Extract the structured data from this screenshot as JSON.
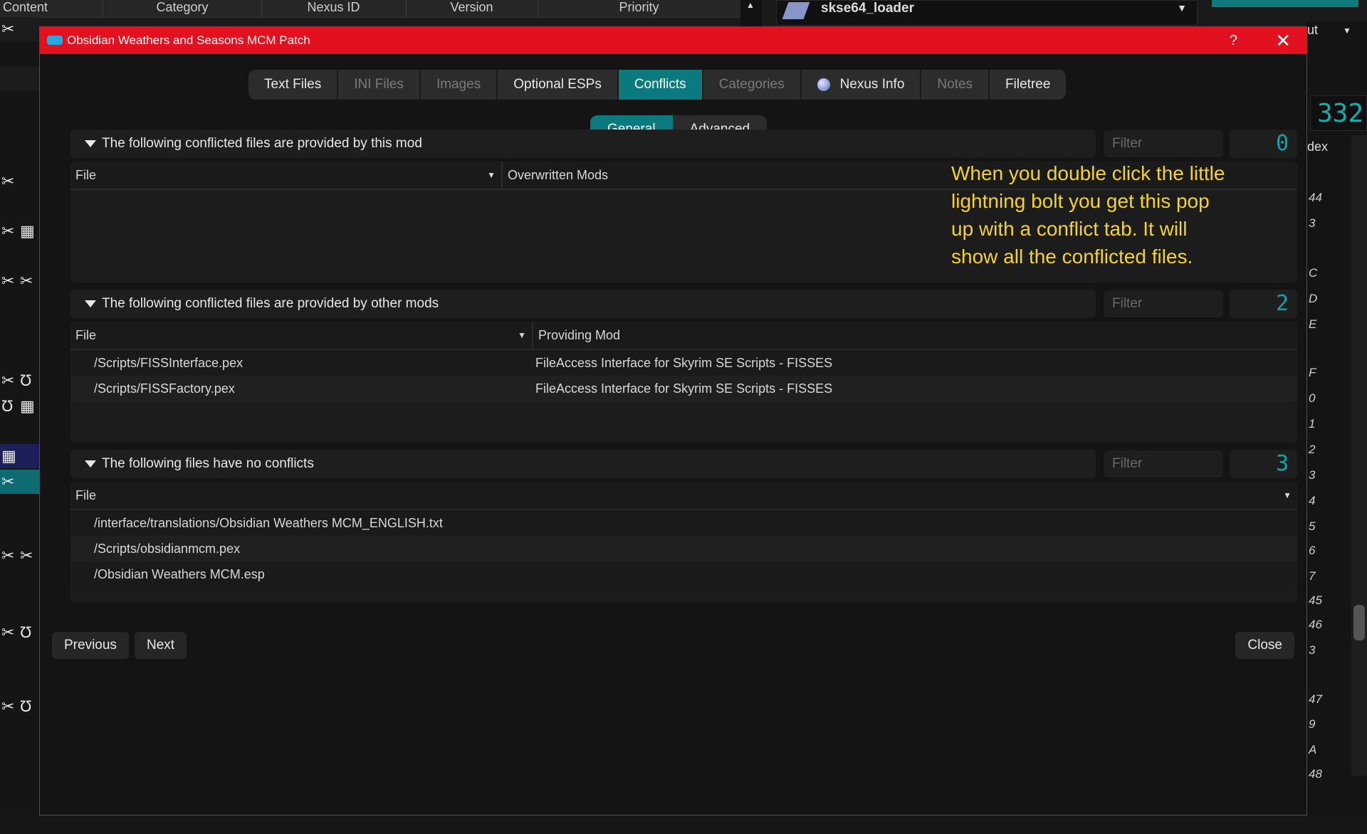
{
  "background": {
    "columns": [
      "Content",
      "Category",
      "Nexus ID",
      "Version",
      "Priority"
    ],
    "executable": "skse64_loader",
    "lcd_value": "332",
    "right_partial_label": "ut",
    "right_partial_header": "dex",
    "right_index_numbers": [
      "44",
      "3",
      "C",
      "D",
      "E",
      "F",
      "0",
      "1",
      "2",
      "3",
      "4",
      "5",
      "6",
      "7",
      "45",
      "46",
      "3",
      "47",
      "9",
      "A",
      "48"
    ]
  },
  "dialog": {
    "title": "Obsidian Weathers and Seasons MCM Patch",
    "help_glyph": "?",
    "close_glyph": "✕",
    "tabs": [
      {
        "label": "Text Files",
        "state": "normal"
      },
      {
        "label": "INI Files",
        "state": "dim"
      },
      {
        "label": "Images",
        "state": "dim"
      },
      {
        "label": "Optional ESPs",
        "state": "normal"
      },
      {
        "label": "Conflicts",
        "state": "active"
      },
      {
        "label": "Categories",
        "state": "dim"
      },
      {
        "label": "Nexus Info",
        "state": "normal",
        "icon": "globe-icon"
      },
      {
        "label": "Notes",
        "state": "dim"
      },
      {
        "label": "Filetree",
        "state": "normal"
      }
    ],
    "subtabs": [
      {
        "label": "General",
        "state": "active"
      },
      {
        "label": "Advanced",
        "state": "normal"
      }
    ],
    "sections": {
      "provided": {
        "header": "The following conflicted files are provided by this mod",
        "filter_placeholder": "Filter",
        "count": "0",
        "columns": [
          "File",
          "Overwritten Mods"
        ],
        "rows": []
      },
      "overwritten": {
        "header": "The following conflicted files are provided by other mods",
        "filter_placeholder": "Filter",
        "count": "2",
        "columns": [
          "File",
          "Providing Mod"
        ],
        "rows": [
          [
            "/Scripts/FISSInterface.pex",
            "FileAccess Interface for Skyrim SE Scripts - FISSES"
          ],
          [
            "/Scripts/FISSFactory.pex",
            "FileAccess Interface for Skyrim SE Scripts - FISSES"
          ]
        ]
      },
      "noconflict": {
        "header": "The following files have no conflicts",
        "filter_placeholder": "Filter",
        "count": "3",
        "columns": [
          "File"
        ],
        "rows": [
          [
            "/interface/translations/Obsidian Weathers MCM_ENGLISH.txt"
          ],
          [
            "/Scripts/obsidianmcm.pex"
          ],
          [
            "/Obsidian Weathers MCM.esp"
          ]
        ]
      }
    },
    "annotation": "When you double click the little lightning bolt you get this pop up with a conflict tab. It will show all the conflicted files.",
    "buttons": {
      "previous": "Previous",
      "next": "Next",
      "close": "Close"
    }
  }
}
